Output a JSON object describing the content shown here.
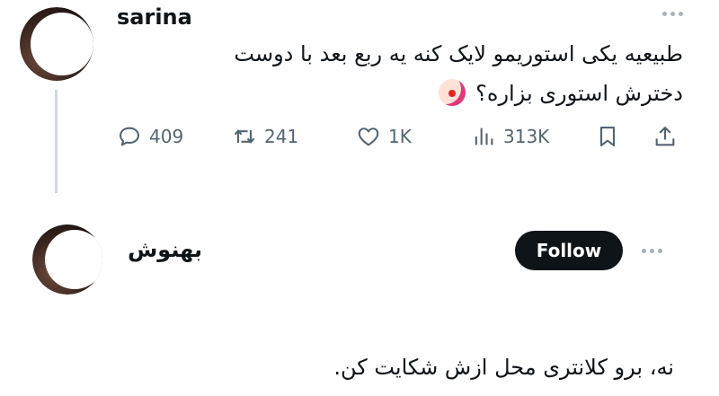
{
  "post": {
    "username": "sarina",
    "text_line1": "طبیعیه یکی استوریمو لایک کنه یه ربع بعد با دوست",
    "text_line2": "دخترش استوری بزاره؟",
    "emoji": "clown-face",
    "stats": {
      "replies": "409",
      "reposts": "241",
      "likes": "1K",
      "views": "313K"
    }
  },
  "reply": {
    "username": "بهنوش",
    "follow_label": "Follow",
    "text": "نه، برو کلانتری محل ازش شکایت کن."
  },
  "colors": {
    "text": "#0f1419",
    "muted": "#536471",
    "follow_bg": "#0f1419",
    "thread_line": "#cfd9de"
  }
}
